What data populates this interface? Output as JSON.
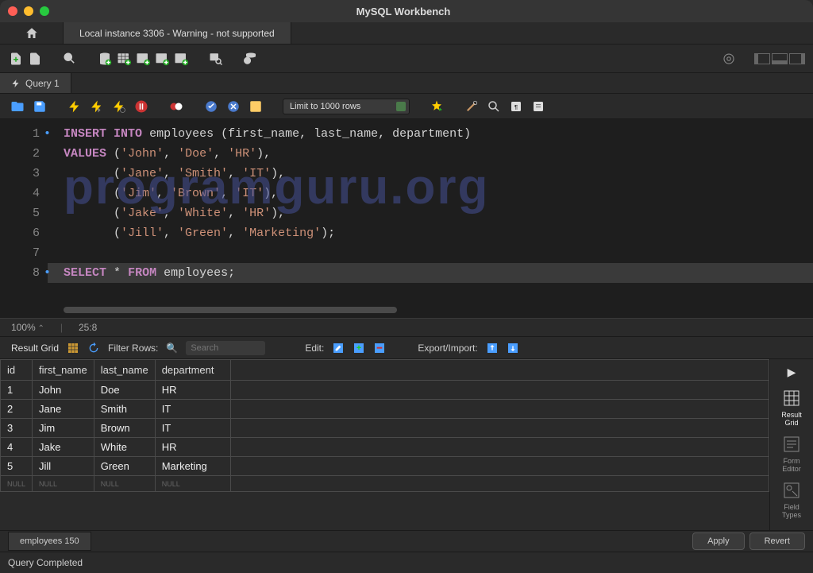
{
  "window": {
    "title": "MySQL Workbench"
  },
  "connection_tab": "Local instance 3306 - Warning - not supported",
  "query_tab": {
    "label": "Query 1"
  },
  "limit_rows": "Limit to 1000 rows",
  "editor": {
    "lines": [
      {
        "n": "1",
        "dot": true
      },
      {
        "n": "2",
        "dot": false
      },
      {
        "n": "3",
        "dot": false
      },
      {
        "n": "4",
        "dot": false
      },
      {
        "n": "5",
        "dot": false
      },
      {
        "n": "6",
        "dot": false
      },
      {
        "n": "7",
        "dot": false
      },
      {
        "n": "8",
        "dot": true
      }
    ],
    "code": {
      "l1_kw1": "INSERT",
      "l1_kw2": "INTO",
      "l1_tbl": "employees",
      "l1_cols": "(first_name, last_name, department)",
      "l2_kw": "VALUES",
      "l2_v": "('John', 'Doe', 'HR'),",
      "l3_v": "('Jane', 'Smith', 'IT'),",
      "l4_v": "('Jim', 'Brown', 'IT'),",
      "l5_v": "('Jake', 'White', 'HR'),",
      "l6_v": "('Jill', 'Green', 'Marketing');",
      "l8_kw1": "SELECT",
      "l8_op": "*",
      "l8_kw2": "FROM",
      "l8_tbl": "employees;"
    }
  },
  "zoom": "100%",
  "cursor": "25:8",
  "result_bar": {
    "label": "Result Grid",
    "filter_label": "Filter Rows:",
    "search_ph": "Search",
    "edit_label": "Edit:",
    "export_label": "Export/Import:"
  },
  "grid": {
    "headers": {
      "id": "id",
      "fn": "first_name",
      "ln": "last_name",
      "dp": "department"
    },
    "rows": [
      {
        "id": "1",
        "fn": "John",
        "ln": "Doe",
        "dp": "HR"
      },
      {
        "id": "2",
        "fn": "Jane",
        "ln": "Smith",
        "dp": "IT"
      },
      {
        "id": "3",
        "fn": "Jim",
        "ln": "Brown",
        "dp": "IT"
      },
      {
        "id": "4",
        "fn": "Jake",
        "ln": "White",
        "dp": "HR"
      },
      {
        "id": "5",
        "fn": "Jill",
        "ln": "Green",
        "dp": "Marketing"
      }
    ],
    "null": "NULL"
  },
  "side": {
    "result": "Result\nGrid",
    "form": "Form\nEditor",
    "field": "Field\nTypes"
  },
  "bottom_tab": "employees 150",
  "buttons": {
    "apply": "Apply",
    "revert": "Revert"
  },
  "status": "Query Completed",
  "watermark": "programguru.org"
}
